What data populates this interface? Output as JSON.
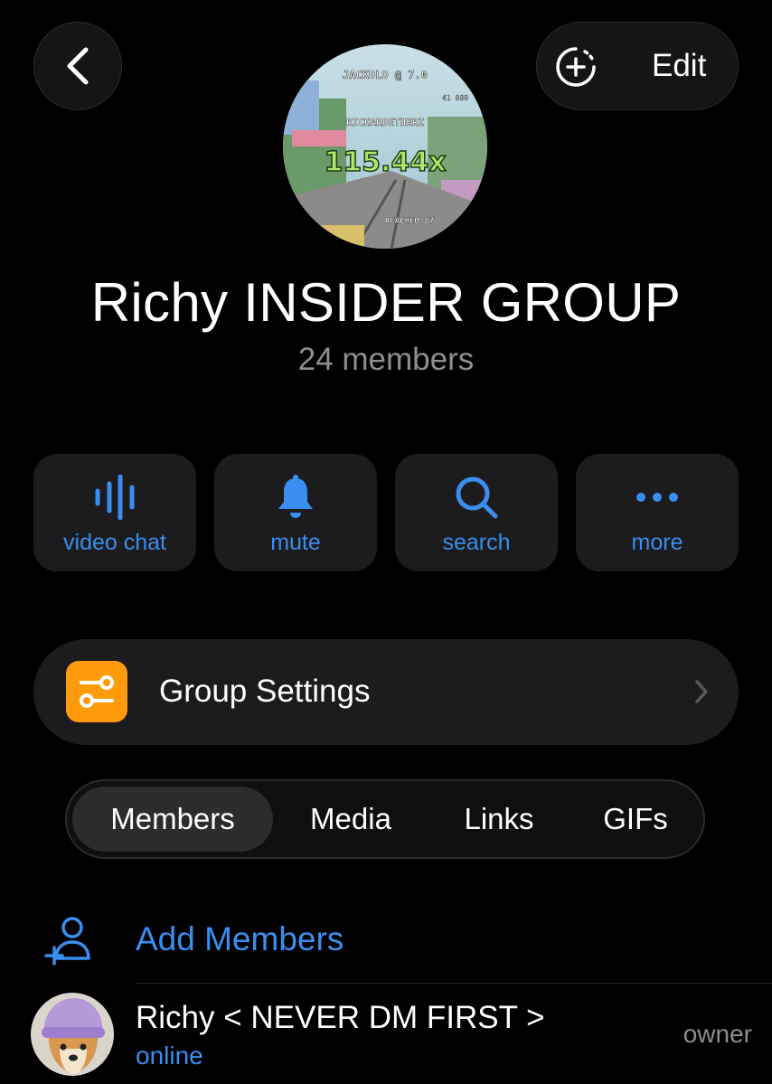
{
  "header": {
    "edit_label": "Edit"
  },
  "group": {
    "title": "Richy INSIDER GROUP",
    "member_count": "24 members",
    "avatar_text": {
      "line1": "JACKOLO @ 7.0",
      "line2": "41 080",
      "line3": "RICHARDETHERZ",
      "multiplier": "115.44x",
      "line5": "REACHED 87"
    }
  },
  "actions": [
    {
      "label": "video chat",
      "icon": "waveform-icon"
    },
    {
      "label": "mute",
      "icon": "bell-icon"
    },
    {
      "label": "search",
      "icon": "search-icon"
    },
    {
      "label": "more",
      "icon": "more-dots-icon"
    }
  ],
  "settings": {
    "label": "Group Settings"
  },
  "tabs": [
    {
      "label": "Members",
      "active": true
    },
    {
      "label": "Media",
      "active": false
    },
    {
      "label": "Links",
      "active": false
    },
    {
      "label": "GIFs",
      "active": false
    }
  ],
  "add_members": {
    "label": "Add Members"
  },
  "members": [
    {
      "name": "Richy < NEVER DM FIRST >",
      "status": "online",
      "role": "owner"
    }
  ],
  "colors": {
    "accent": "#3a8ef0",
    "settings_icon_bg": "#ff9a0a",
    "secondary_text": "#8e8e93",
    "card_bg": "#1c1c1e"
  }
}
